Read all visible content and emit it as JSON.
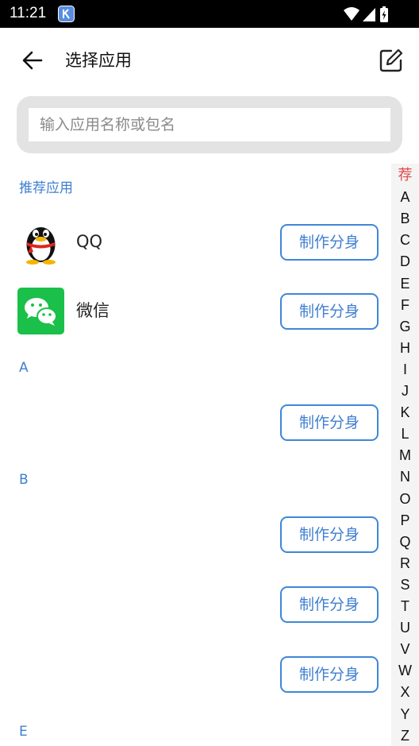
{
  "status_bar": {
    "time": "11:21"
  },
  "header": {
    "title": "选择应用"
  },
  "search": {
    "placeholder": "输入应用名称或包名",
    "value": ""
  },
  "button_label": "制作分身",
  "sections": {
    "recommended": {
      "title": "推荐应用",
      "apps": [
        {
          "name": "QQ",
          "icon": "qq-penguin-icon"
        },
        {
          "name": "微信",
          "icon": "wechat-icon"
        }
      ]
    },
    "a": {
      "title": "A",
      "apps": [
        {
          "name": ""
        }
      ]
    },
    "b": {
      "title": "B",
      "apps": [
        {
          "name": ""
        },
        {
          "name": ""
        },
        {
          "name": ""
        }
      ]
    },
    "e": {
      "title": "E"
    }
  },
  "index_bar": {
    "letters": [
      "荐",
      "A",
      "B",
      "C",
      "D",
      "E",
      "F",
      "G",
      "H",
      "I",
      "J",
      "K",
      "L",
      "M",
      "N",
      "O",
      "P",
      "Q",
      "R",
      "S",
      "T",
      "U",
      "V",
      "W",
      "X",
      "Y",
      "Z"
    ],
    "active": "荐"
  },
  "colors": {
    "accent": "#3f7fd0",
    "index_active": "#e04848",
    "status_bar": "#000000"
  }
}
